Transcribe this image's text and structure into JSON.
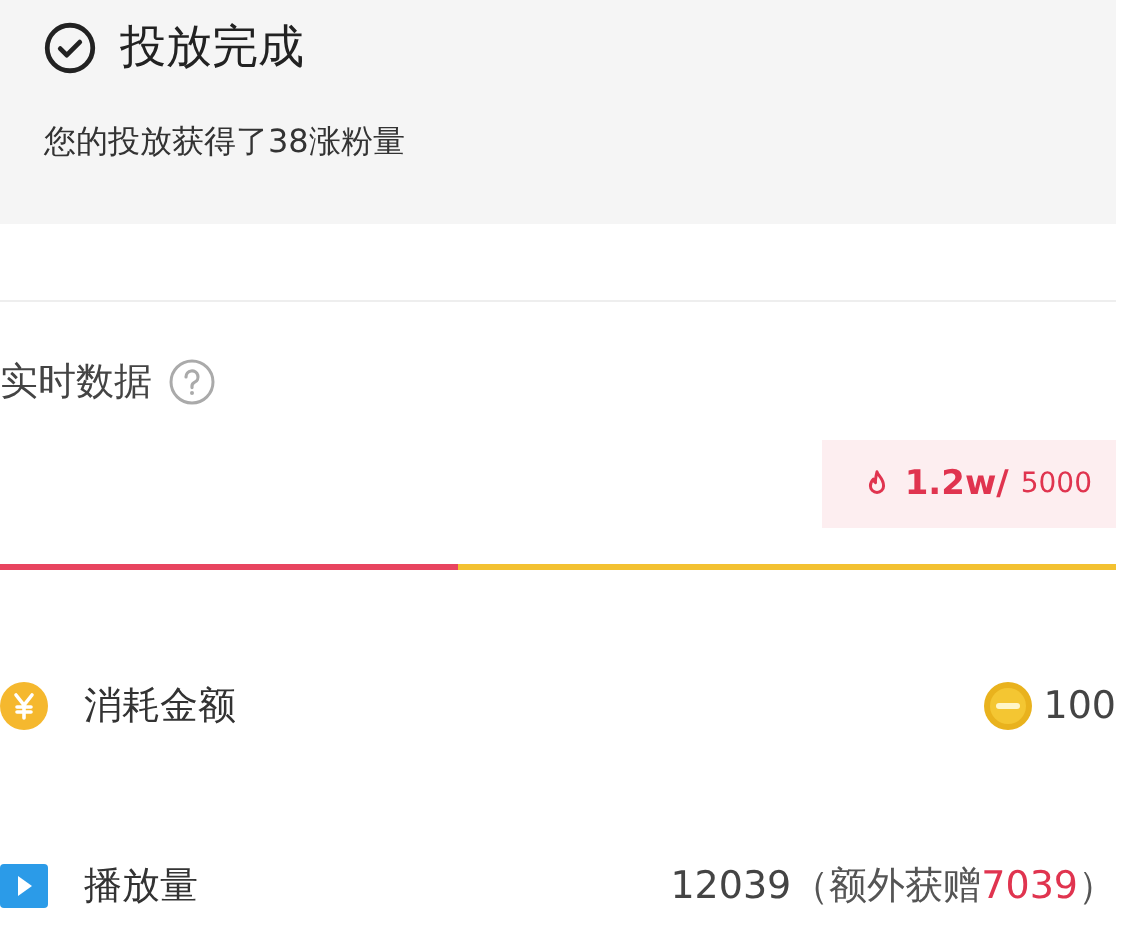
{
  "status_card": {
    "title": "投放完成",
    "message": "您的投放获得了38涨粉量"
  },
  "realtime": {
    "title": "实时数据",
    "tooltip": {
      "current": "1.2w/",
      "target": "5000"
    },
    "progress": {
      "level": 0.41
    }
  },
  "metrics": [
    {
      "kind": "money",
      "label": "消耗金额",
      "value": "100"
    },
    {
      "kind": "play",
      "label": "播放量",
      "value": "12039",
      "note_prefix": "（额外获赠",
      "bonus": "7039",
      "note_suffix": "）"
    }
  ]
}
